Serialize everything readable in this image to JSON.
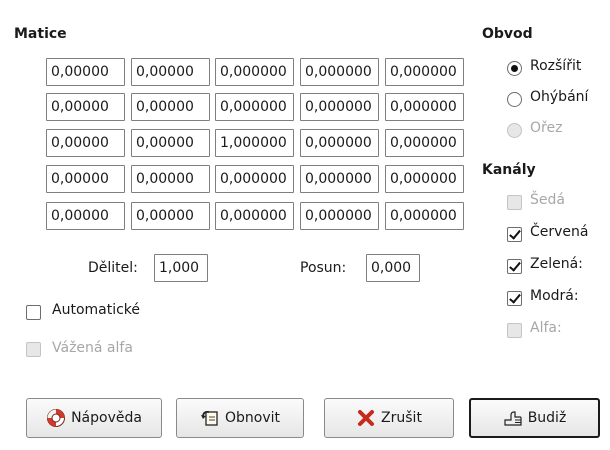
{
  "matrix": {
    "heading": "Matice",
    "rows": [
      [
        "0,00000",
        "0,00000",
        "0,000000",
        "0,000000",
        "0,000000"
      ],
      [
        "0,00000",
        "0,00000",
        "0,000000",
        "0,000000",
        "0,000000"
      ],
      [
        "0,00000",
        "0,00000",
        "1,000000",
        "0,000000",
        "0,000000"
      ],
      [
        "0,00000",
        "0,00000",
        "0,000000",
        "0,000000",
        "0,000000"
      ],
      [
        "0,00000",
        "0,00000",
        "0,000000",
        "0,000000",
        "0,000000"
      ]
    ],
    "divisor_label": "Dělitel:",
    "divisor_value": "1,000",
    "offset_label": "Posun:",
    "offset_value": "0,000",
    "automatic_label": "Automatické",
    "automatic_checked": false,
    "weighted_alpha_label": "Vážená alfa",
    "weighted_alpha_checked": false
  },
  "border": {
    "heading": "Obvod",
    "options": [
      {
        "label": "Rozšířit",
        "checked": true,
        "disabled": false
      },
      {
        "label": "Ohýbání",
        "checked": false,
        "disabled": false
      },
      {
        "label": "Ořez",
        "checked": false,
        "disabled": true
      }
    ]
  },
  "channels": {
    "heading": "Kanály",
    "items": [
      {
        "label": "Šedá",
        "checked": false,
        "disabled": true
      },
      {
        "label": "Červená",
        "checked": true,
        "disabled": false
      },
      {
        "label": "Zelená:",
        "checked": true,
        "disabled": false
      },
      {
        "label": "Modrá:",
        "checked": true,
        "disabled": false
      },
      {
        "label": "Alfa:",
        "checked": false,
        "disabled": true
      }
    ]
  },
  "buttons": {
    "help": "Nápověda",
    "reset": "Obnovit",
    "cancel": "Zrušit",
    "ok": "Budiž"
  },
  "icons": {
    "help": "lifebuoy-icon",
    "reset": "undo-icon",
    "cancel": "cancel-x-icon",
    "ok": "ok-hand-icon"
  },
  "colors": {
    "lifebuoy_red": "#d03a2a",
    "cancel_red": "#c42b1c"
  }
}
